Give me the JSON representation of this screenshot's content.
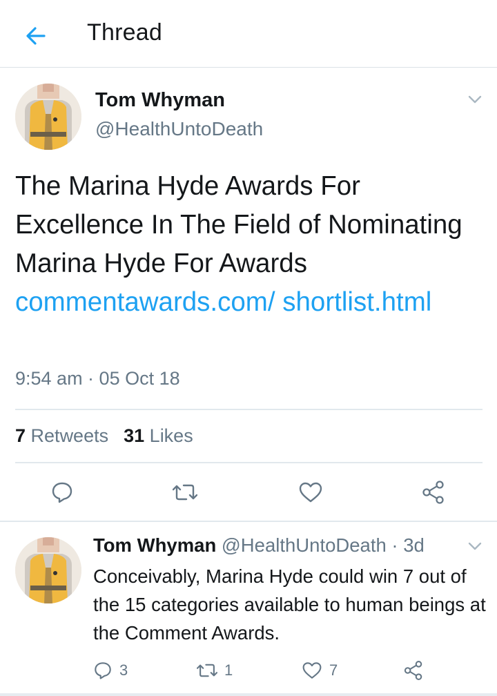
{
  "header": {
    "title": "Thread"
  },
  "main_tweet": {
    "author_name": "Tom Whyman",
    "handle": "@HealthUntoDeath",
    "text": "The Marina Hyde Awards For Excellence In The Field of Nominating Marina Hyde For Awards ",
    "link": "commentawards.com/ shortlist.html",
    "timestamp": "9:54 am · 05 Oct 18",
    "retweets_count": "7",
    "retweets_label": "Retweets",
    "likes_count": "31",
    "likes_label": "Likes"
  },
  "reply": {
    "author_name": "Tom Whyman",
    "handle_time": "@HealthUntoDeath · 3d",
    "text": "Conceivably, Marina Hyde could win 7 out of the 15 categories available to human beings at the Comment Awards.",
    "reply_count": "3",
    "retweet_count": "1",
    "like_count": "7"
  },
  "colors": {
    "accent": "#1da1f2",
    "text_primary": "#14171a",
    "text_secondary": "#657786",
    "icon": "#657786",
    "divider": "#e1e8ed"
  },
  "icons": [
    "back-arrow-icon",
    "chevron-down-icon",
    "reply-icon",
    "retweet-icon",
    "like-icon",
    "share-icon"
  ]
}
